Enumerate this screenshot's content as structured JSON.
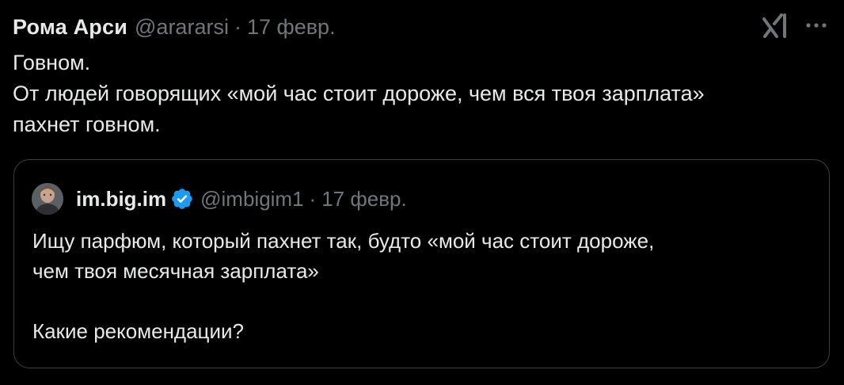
{
  "tweet": {
    "author_name": "Рома Арси",
    "author_handle": "@arararsi",
    "separator": "·",
    "date": "17 февр.",
    "text_lines": [
      "Говном.",
      "От людей говорящих «мой час стоит дороже, чем вся твоя зарплата»",
      "пахнет говном."
    ]
  },
  "quote": {
    "author_name": "im.big.im",
    "author_handle": "@imbigim1",
    "separator": "·",
    "date": "17 февр.",
    "verified": true,
    "text_lines": [
      "Ищу парфюм, который пахнет так, будто «мой час стоит дороже,",
      "чем твоя месячная зарплата»",
      "",
      "Какие рекомендации?"
    ]
  },
  "icons": {
    "grok": "grok-xai-icon",
    "more": "more-dots-icon",
    "verified": "verified-badge-icon",
    "avatar": "user-avatar"
  },
  "colors": {
    "background": "#000000",
    "text": "#e7e9ea",
    "secondary_text": "#71767b",
    "border": "#3a3f44",
    "verified_blue": "#1d9bf0"
  }
}
